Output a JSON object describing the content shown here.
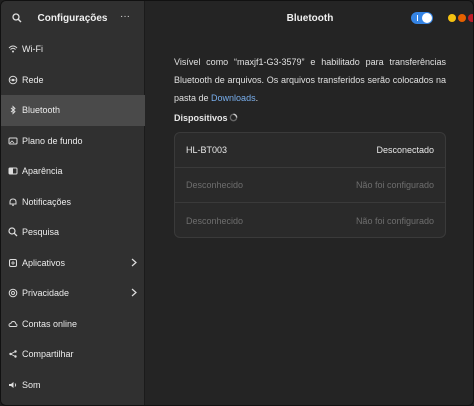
{
  "sidebar": {
    "title": "Configurações",
    "menu_label": "···",
    "items": [
      {
        "label": "Wi-Fi",
        "icon": "wifi-icon"
      },
      {
        "label": "Rede",
        "icon": "network-icon"
      },
      {
        "label": "Bluetooth",
        "icon": "bluetooth-icon",
        "active": true
      },
      {
        "label": "Plano de fundo",
        "icon": "wallpaper-icon"
      },
      {
        "label": "Aparência",
        "icon": "appearance-icon"
      },
      {
        "label": "Notificações",
        "icon": "bell-icon"
      },
      {
        "label": "Pesquisa",
        "icon": "search-icon"
      },
      {
        "label": "Aplicativos",
        "icon": "apps-icon",
        "chevron": true
      },
      {
        "label": "Privacidade",
        "icon": "privacy-icon",
        "chevron": true
      },
      {
        "label": "Contas online",
        "icon": "cloud-icon"
      },
      {
        "label": "Compartilhar",
        "icon": "share-icon"
      },
      {
        "label": "Som",
        "icon": "speaker-icon"
      }
    ]
  },
  "header": {
    "title": "Bluetooth",
    "toggle_on": true,
    "window_controls": [
      "#3584e4",
      "#f5c211",
      "#e66100",
      "#c01c28"
    ]
  },
  "main": {
    "description_text": "Visível como “maxjf1-G3-3579” e habilitado para transferências Bluetooth de arquivos. Os arquivos transferidos serão colocados na pasta de",
    "description_link": "Downloads",
    "description_end": ".",
    "devices_title": "Dispositivos",
    "devices": [
      {
        "name": "HL-BT003",
        "status": "Desconectado",
        "dim": false
      },
      {
        "name": "Desconhecido",
        "status": "Não foi configurado",
        "dim": true
      },
      {
        "name": "Desconhecido",
        "status": "Não foi configurado",
        "dim": true
      }
    ]
  },
  "colors": {
    "accent": "#3584e4",
    "link": "#78aeed"
  }
}
